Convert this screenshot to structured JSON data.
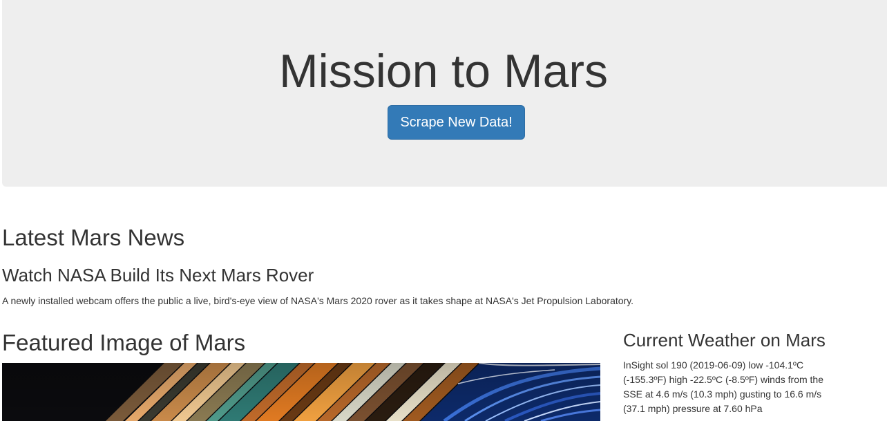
{
  "header": {
    "title": "Mission to Mars",
    "scrape_button_label": "Scrape New Data!"
  },
  "news": {
    "heading": "Latest Mars News",
    "title": "Watch NASA Build Its Next Mars Rover",
    "paragraph": "A newly installed webcam offers the public a live, bird's-eye view of NASA's Mars 2020 rover as it takes shape at NASA's Jet Propulsion Laboratory."
  },
  "featured_image": {
    "heading": "Featured Image of Mars"
  },
  "weather": {
    "heading": "Current Weather on Mars",
    "report": "InSight sol 190 (2019-06-09) low -104.1ºC (-155.3ºF) high -22.5ºC (-8.5ºF) winds from the SSE at 4.6 m/s (10.3 mph) gusting to 16.6 m/s (37.1 mph) pressure at 7.60 hPa"
  },
  "colors": {
    "jumbotron_bg": "#eeeeee",
    "primary_button": "#337ab7",
    "text": "#333333"
  }
}
